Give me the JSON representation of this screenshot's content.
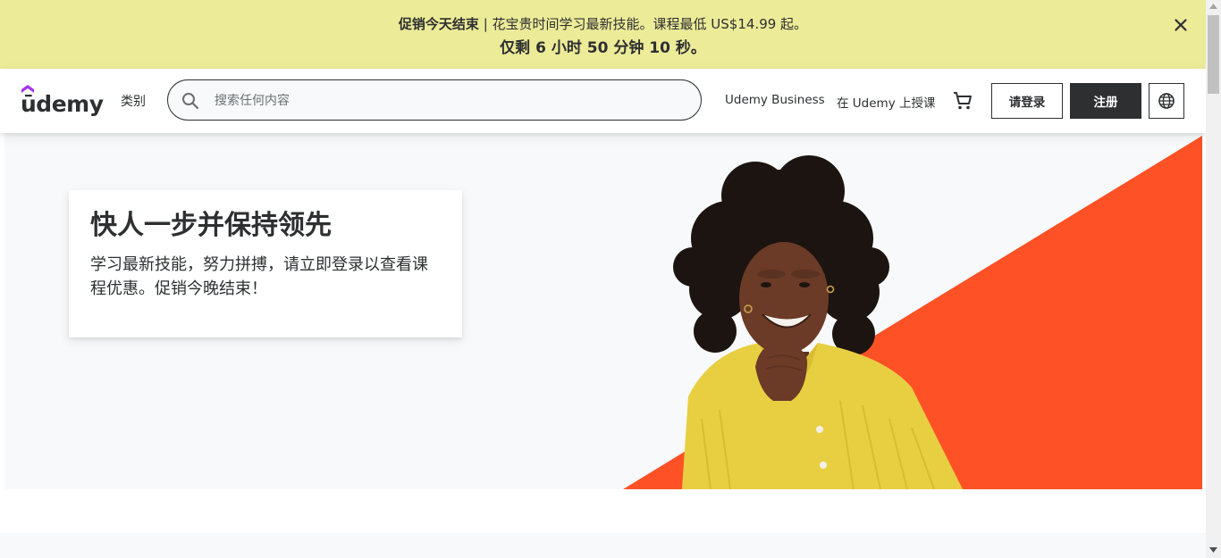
{
  "promo": {
    "headline_bold": "促销今天结束",
    "headline_rest": " | 花宝贵时间学习最新技能。课程最低 US$14.99 起。",
    "countdown": "仅剩 6 小时 50 分钟 10 秒。",
    "close_icon": "close-icon"
  },
  "header": {
    "logo_text": "ūdemy",
    "categories_label": "类别",
    "search": {
      "placeholder": "搜索任何内容",
      "value": ""
    },
    "business_link": "Udemy Business",
    "teach_link": "在 Udemy 上授课",
    "cart_icon": "cart-icon",
    "login_label": "请登录",
    "signup_label": "注册",
    "language_icon": "globe-icon"
  },
  "hero": {
    "title": "快人一步并保持领先",
    "subtitle": "学习最新技能，努力拼搏，请立即登录以查看课程优惠。促销今晚结束！"
  },
  "colors": {
    "banner": "#eceb98",
    "dark": "#2d2f31",
    "accent_orange": "#ff5126",
    "shirt_yellow": "#e8cf42",
    "brand_purple": "#a435f0"
  }
}
